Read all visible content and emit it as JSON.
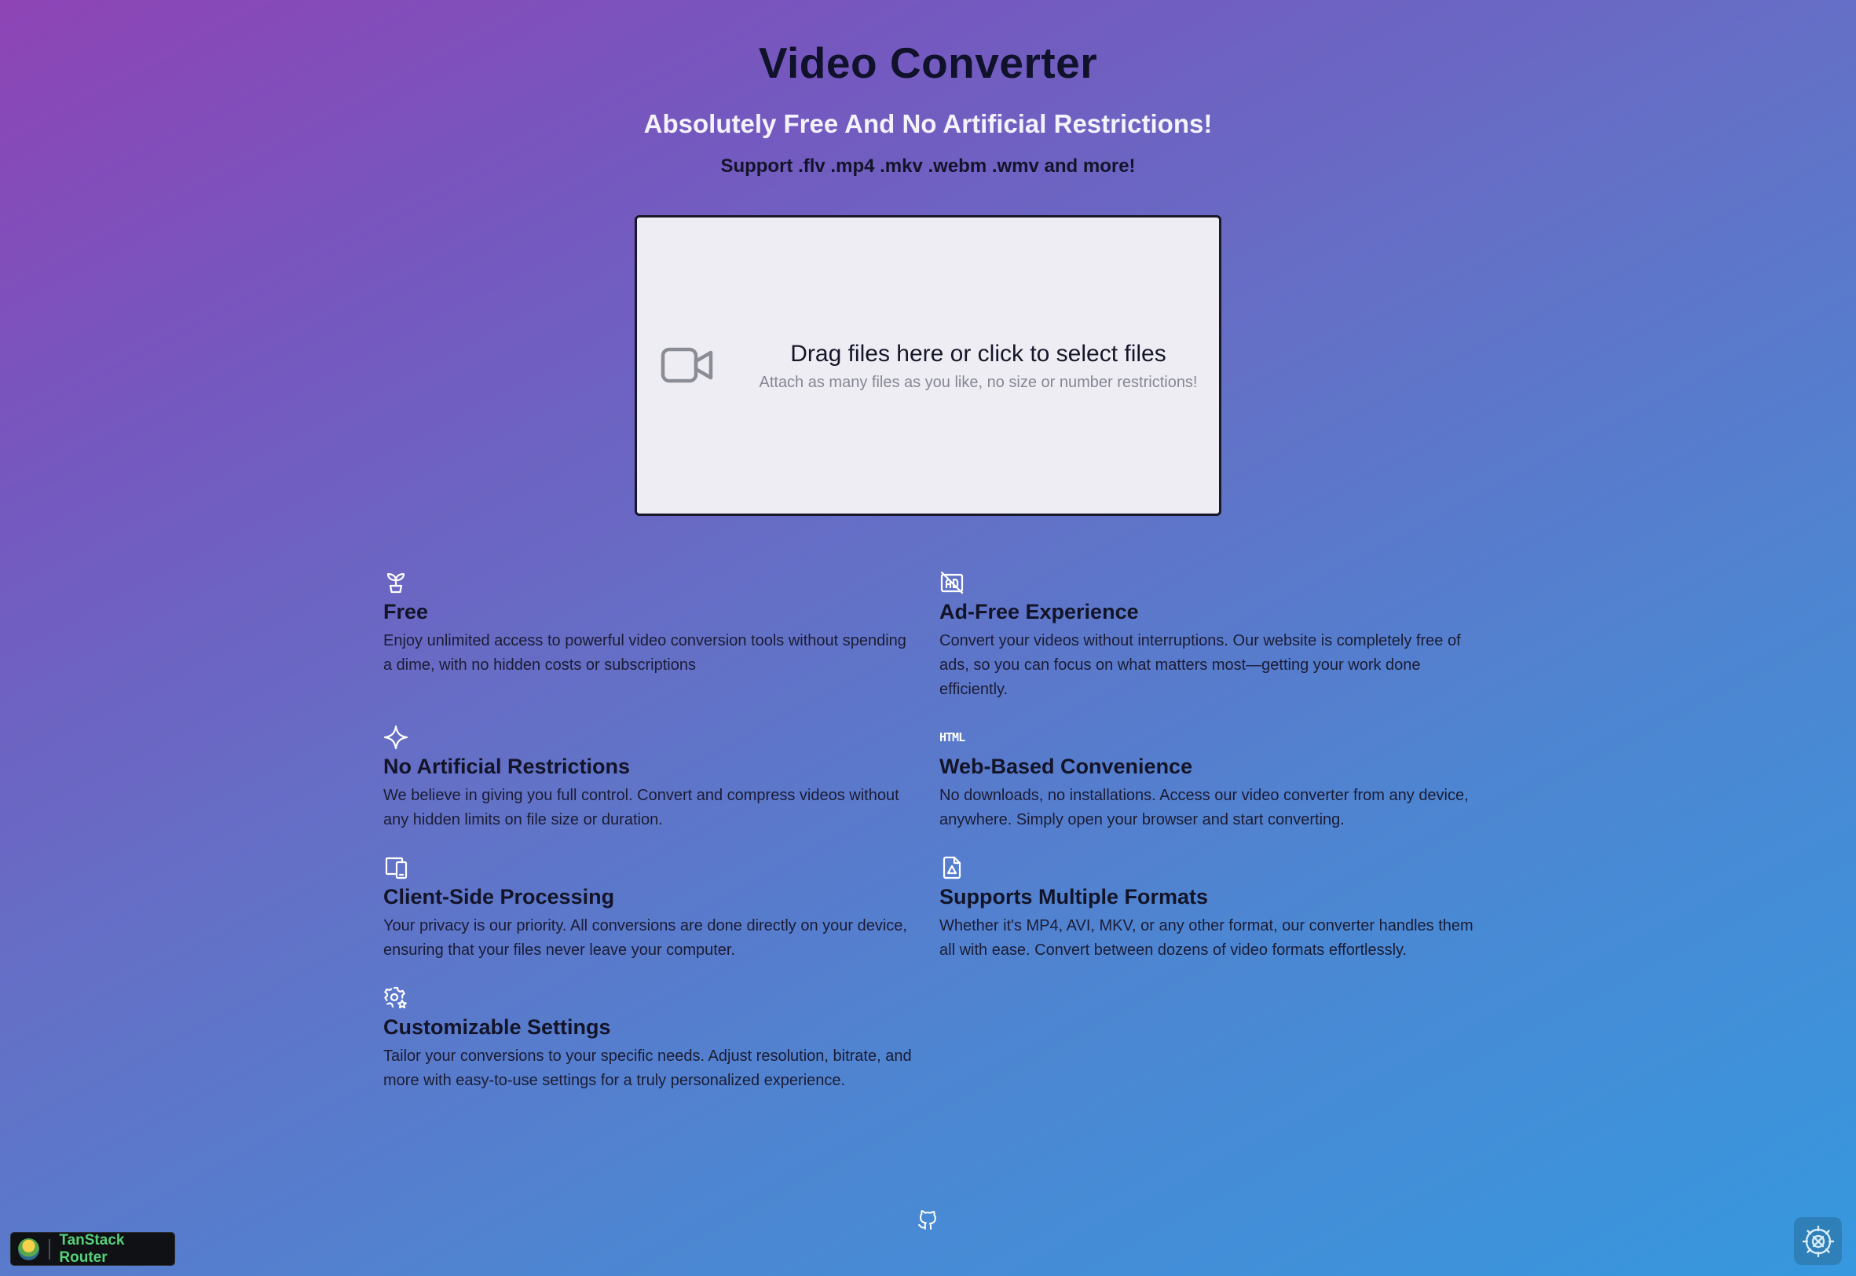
{
  "header": {
    "title": "Video Converter",
    "subtitle": "Absolutely Free And No Artificial Restrictions!",
    "formats": "Support .flv .mp4 .mkv .webm .wmv and more!"
  },
  "dropzone": {
    "icon": "video-camera-icon",
    "main_text": "Drag files here or click to select files",
    "sub_text": "Attach as many files as you like, no size or number restrictions!"
  },
  "features": [
    {
      "icon": "plant-sprout-icon",
      "title": "Free",
      "description": "Enjoy unlimited access to powerful video conversion tools without spending a dime, with no hidden costs or subscriptions"
    },
    {
      "icon": "ad-off-icon",
      "title": "Ad-Free Experience",
      "description": "Convert your videos without interruptions. Our website is completely free of ads, so you can focus on what matters most—getting your work done efficiently."
    },
    {
      "icon": "sparkle-icon",
      "title": "No Artificial Restrictions",
      "description": "We believe in giving you full control. Convert and compress videos without any hidden limits on file size or duration."
    },
    {
      "icon": "html-icon",
      "icon_text": "HTML",
      "title": "Web-Based Convenience",
      "description": "No downloads, no installations. Access our video converter from any device, anywhere. Simply open your browser and start converting."
    },
    {
      "icon": "devices-icon",
      "title": "Client-Side Processing",
      "description": "Your privacy is our priority. All conversions are done directly on your device, ensuring that your files never leave your computer."
    },
    {
      "icon": "file-format-icon",
      "title": "Supports Multiple Formats",
      "description": "Whether it's MP4, AVI, MKV, or any other format, our converter handles them all with ease. Convert between dozens of video formats effortlessly."
    },
    {
      "icon": "settings-star-icon",
      "title": "Customizable Settings",
      "description": "Tailor your conversions to your specific needs. Adjust resolution, bitrate, and more with easy-to-use settings for a truly personalized experience."
    }
  ],
  "footer": {
    "github_icon": "github-icon",
    "devtools_label": "TanStack Router",
    "settings_icon": "query-devtools-icon"
  },
  "colors": {
    "gradient_start": "#8e44b5",
    "gradient_end": "#3698de",
    "dropzone_bg": "#eeedf3",
    "devtools_label": "#56d07a"
  }
}
